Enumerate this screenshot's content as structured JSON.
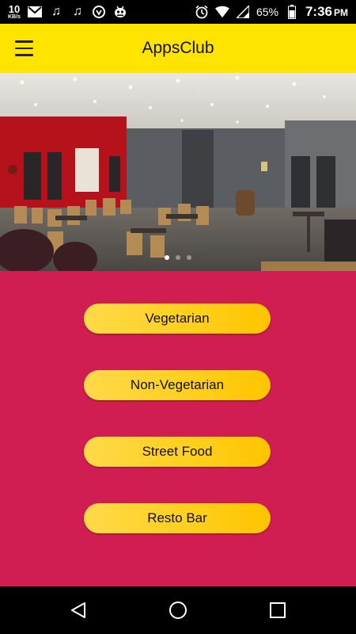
{
  "status_bar": {
    "net_speed_value": "10",
    "net_speed_unit": "KB/s",
    "icons": [
      "gmail-icon",
      "music-note-icon",
      "music-note-icon",
      "vpn-shield-icon",
      "bug-robot-icon"
    ],
    "right_icons": [
      "alarm-icon",
      "wifi-icon",
      "signal-icon"
    ],
    "battery_percent": "65%",
    "time": "7:36",
    "ampm": "PM"
  },
  "app_bar": {
    "title": "AppsClub",
    "menu_icon": "hamburger-menu-icon",
    "background": "#ffe400"
  },
  "hero": {
    "image_subject": "restaurant interior with wooden chairs and tables",
    "carousel_pages": 3,
    "active_page": 1
  },
  "categories": [
    {
      "label": "Vegetarian"
    },
    {
      "label": "Non-Vegetarian"
    },
    {
      "label": "Street Food"
    },
    {
      "label": "Resto Bar"
    }
  ],
  "colors": {
    "content_background": "#d01e52",
    "button_gradient_start": "#ffd94a",
    "button_gradient_end": "#ffc400"
  },
  "nav_bar": {
    "buttons": [
      "back-icon",
      "home-icon",
      "recents-icon"
    ]
  }
}
